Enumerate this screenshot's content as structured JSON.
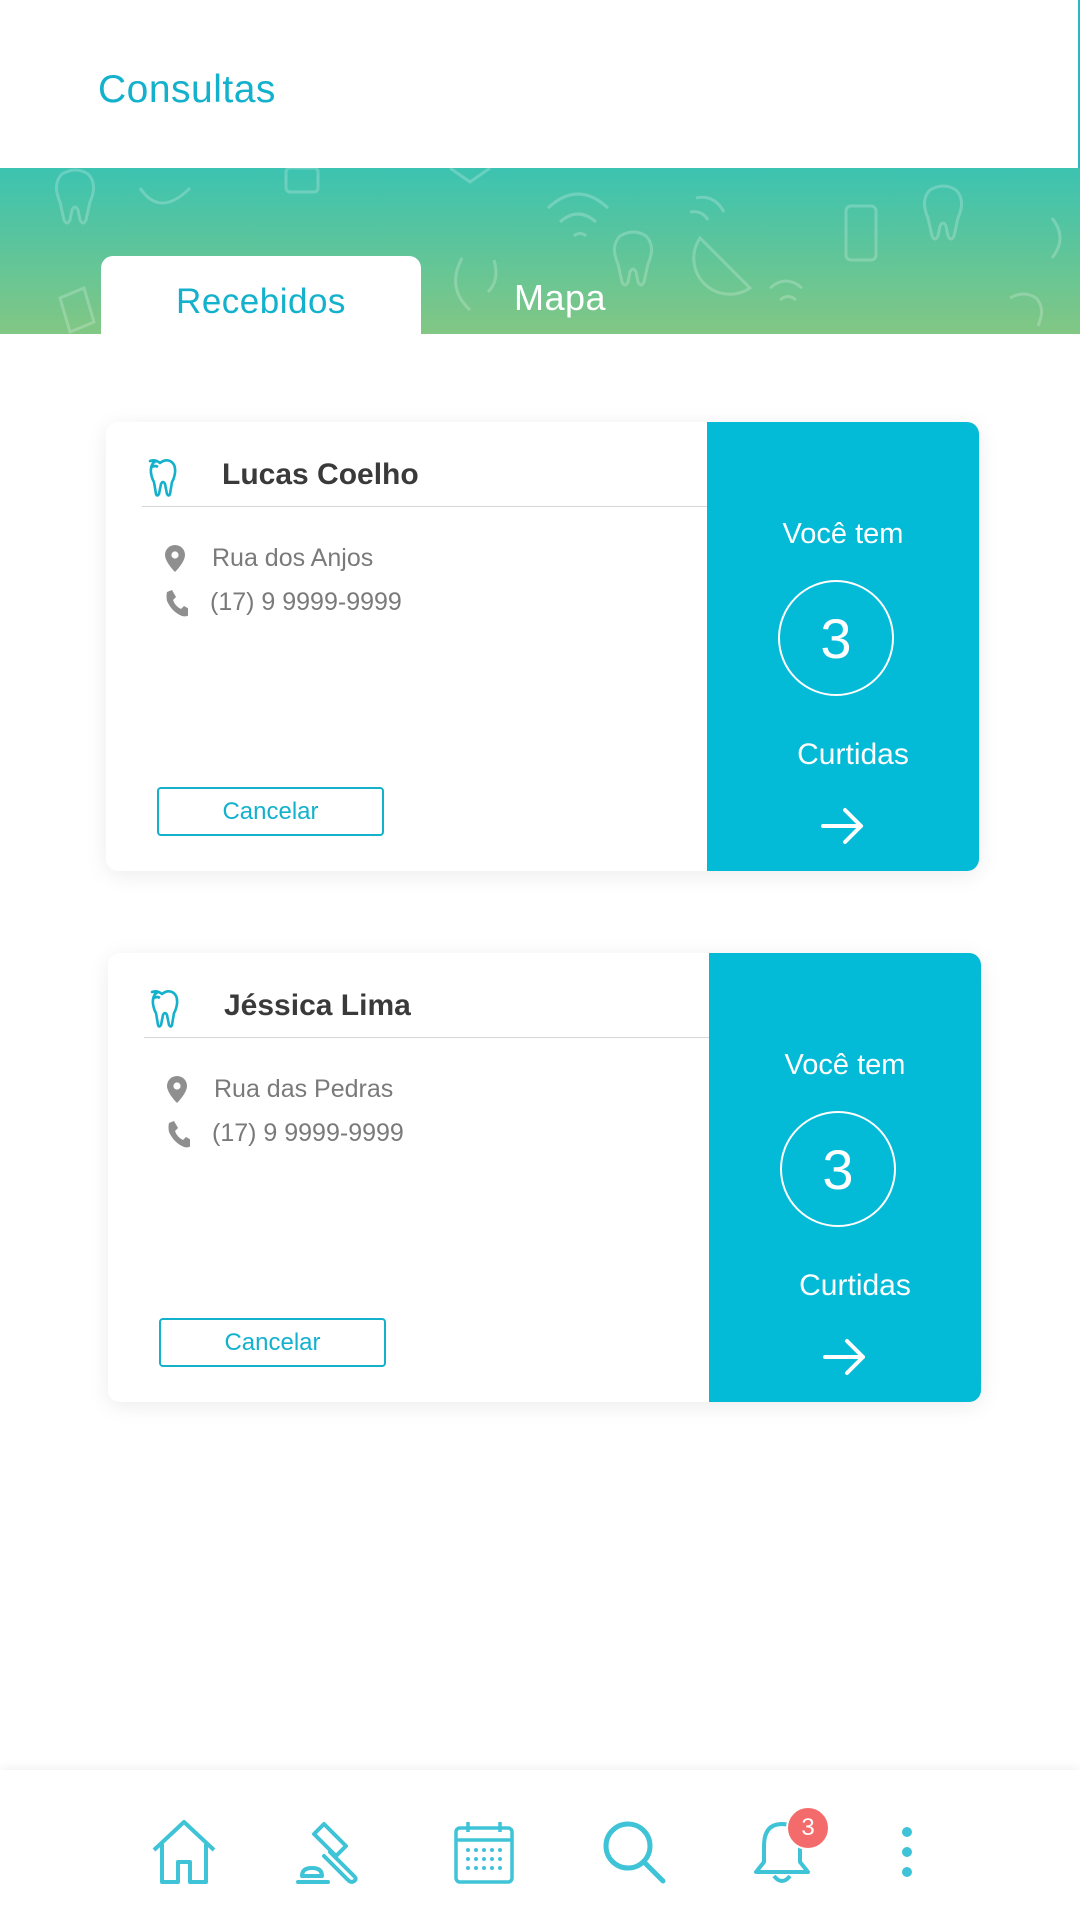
{
  "header": {
    "title": "Consultas"
  },
  "tabs": [
    {
      "label": "Recebidos",
      "active": true
    },
    {
      "label": "Mapa",
      "active": false
    }
  ],
  "cards": [
    {
      "name": "Lucas Coelho",
      "address": "Rua dos Anjos",
      "phone": "(17) 9 9999-9999",
      "cancel_label": "Cancelar",
      "side_top": "Você tem",
      "count": "3",
      "side_bottom": "Curtidas"
    },
    {
      "name": "Jéssica Lima",
      "address": "Rua das Pedras",
      "phone": "(17) 9 9999-9999",
      "cancel_label": "Cancelar",
      "side_top": "Você tem",
      "count": "3",
      "side_bottom": "Curtidas"
    }
  ],
  "bottom_nav": {
    "items": [
      {
        "icon": "home-icon"
      },
      {
        "icon": "auction-gavel-icon"
      },
      {
        "icon": "calendar-icon"
      },
      {
        "icon": "search-icon"
      },
      {
        "icon": "bell-icon"
      },
      {
        "icon": "more-vertical-icon"
      }
    ],
    "notification_count": "3"
  },
  "colors": {
    "accent": "#14b1cc",
    "card_side": "#04bbd7",
    "badge": "#f36b6b",
    "banner_top": "#3cc3b1",
    "banner_bottom": "#82c784"
  }
}
